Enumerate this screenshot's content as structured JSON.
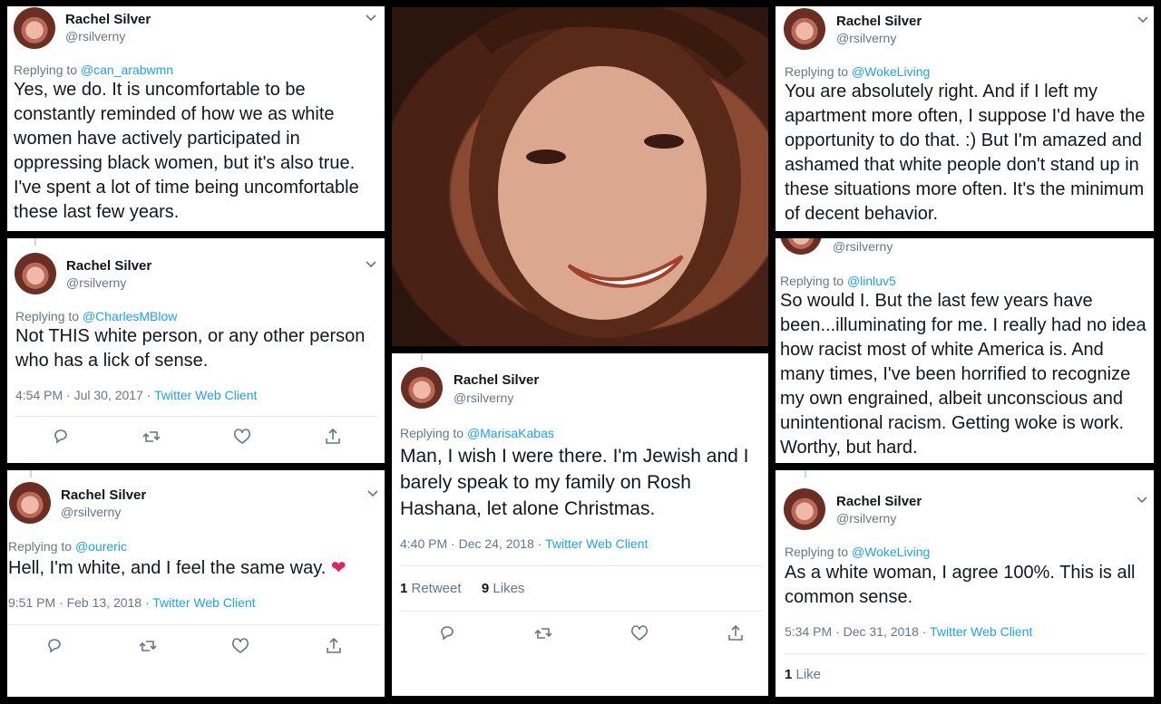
{
  "user": {
    "name": "Rachel Silver",
    "handle": "@rsilverny"
  },
  "tweets": {
    "t1": {
      "replying_prefix": "Replying to ",
      "replying_to": "@can_arabwmn",
      "text": "Yes, we do. It is uncomfortable to be constantly reminded of how we as white women have actively participated in oppressing black women, but it's also true. I've spent a lot of time being uncomfortable these last few years."
    },
    "t2": {
      "replying_prefix": "Replying to ",
      "replying_to": "@CharlesMBlow",
      "text": "Not THIS white person, or any other person who has a lick of sense.",
      "time": "4:54 PM · Jul 30, 2017 · ",
      "source": "Twitter Web Client"
    },
    "t3": {
      "replying_prefix": "Replying to ",
      "replying_to": "@oureric",
      "text": "Hell, I'm white, and I feel the same way.",
      "emoji": "❤",
      "time": "9:51 PM · Feb 13, 2018 · ",
      "source": "Twitter Web Client"
    },
    "t4": {
      "replying_prefix": "Replying to ",
      "replying_to": "@MarisaKabas",
      "text": "Man, I wish I were there. I'm Jewish and I barely speak to my family on Rosh Hashana, let alone Christmas.",
      "time": "4:40 PM · Dec 24, 2018 · ",
      "source": "Twitter Web Client",
      "retweets_count": "1",
      "retweets_label": " Retweet",
      "likes_count": "9",
      "likes_label": " Likes"
    },
    "t5": {
      "replying_prefix": "Replying to ",
      "replying_to": "@WokeLiving",
      "text": "You are absolutely right. And if I left my apartment more often, I suppose I'd have the opportunity to do that. :) But I'm amazed and ashamed that white people don't stand up in these situations more often. It's the minimum of decent behavior."
    },
    "t6": {
      "replying_prefix": "Replying to ",
      "replying_to": "@linluv5",
      "text": "So would I. But the last few years have been...illuminating for me. I really had no idea how racist most of white America is. And many times, I've been horrified to recognize my own engrained, albeit unconscious and unintentional racism. Getting woke is work. Worthy, but hard."
    },
    "t7": {
      "replying_prefix": "Replying to ",
      "replying_to": "@WokeLiving",
      "text": "As a white woman, I agree 100%. This is all common sense.",
      "time": "5:34 PM · Dec 31, 2018 · ",
      "source": "Twitter Web Client",
      "likes_count": "1",
      "likes_label": " Like"
    }
  },
  "colors": {
    "link": "#1da1f2",
    "muted": "#657786",
    "text": "#14171a",
    "heart": "#e0245e"
  },
  "icons": [
    "reply-icon",
    "retweet-icon",
    "like-icon",
    "share-icon",
    "chevron-down-icon"
  ]
}
